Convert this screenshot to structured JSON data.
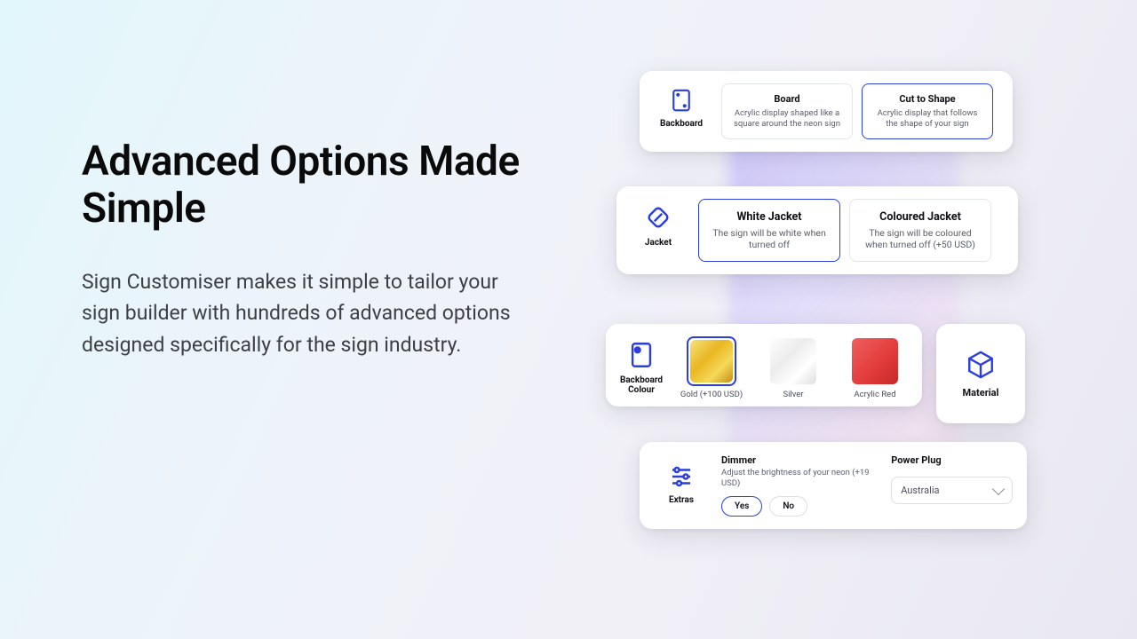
{
  "hero": {
    "heading": "Advanced Options Made Simple",
    "subtext": "Sign Customiser makes it simple to tailor your sign builder with hundreds of advanced options designed specifically for the sign industry."
  },
  "backboard": {
    "label": "Backboard",
    "options": [
      {
        "title": "Board",
        "desc": "Acrylic display shaped like a square around the neon sign",
        "selected": false
      },
      {
        "title": "Cut to Shape",
        "desc": "Acrylic display that follows the shape of your sign",
        "selected": true
      }
    ]
  },
  "jacket": {
    "label": "Jacket",
    "options": [
      {
        "title": "White Jacket",
        "desc": "The sign will be white when turned off",
        "selected": true
      },
      {
        "title": "Coloured Jacket",
        "desc": "The sign will be coloured when turned off (+50 USD)",
        "selected": false
      }
    ]
  },
  "backboard_colour": {
    "label": "Backboard Colour",
    "swatches": [
      {
        "name": "Gold (+100 USD)",
        "selected": true
      },
      {
        "name": "Silver",
        "selected": false
      },
      {
        "name": "Acrylic Red",
        "selected": false
      }
    ]
  },
  "material": {
    "label": "Material"
  },
  "extras": {
    "label": "Extras",
    "dimmer": {
      "title": "Dimmer",
      "desc": "Adjust the brightness of your neon (+19 USD)",
      "yes": "Yes",
      "no": "No",
      "selected": "Yes"
    },
    "plug": {
      "title": "Power Plug",
      "value": "Australia"
    }
  }
}
